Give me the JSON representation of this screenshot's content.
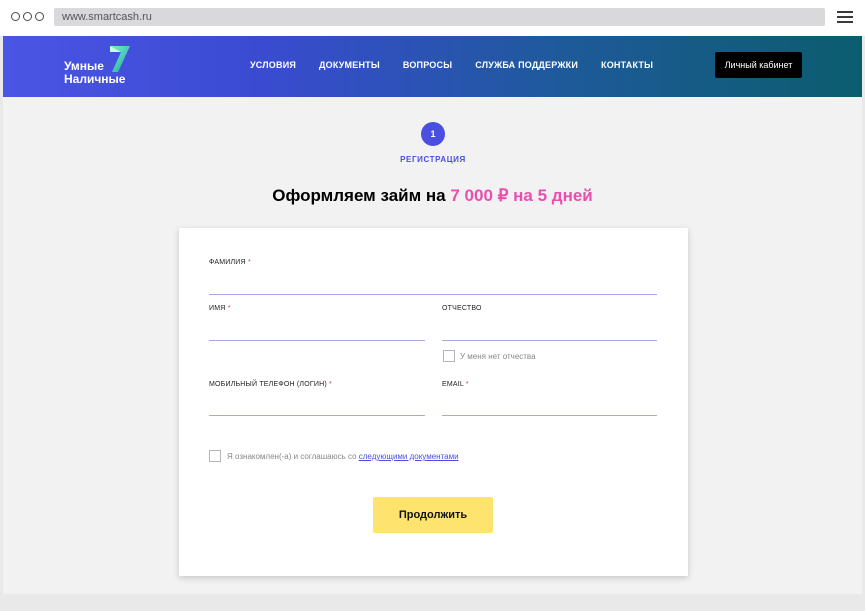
{
  "browser": {
    "url": "www.smartcash.ru"
  },
  "header": {
    "logo_line1": "Умные",
    "logo_line2": "Наличные",
    "nav": [
      {
        "label": "УСЛОВИЯ"
      },
      {
        "label": "ДОКУМЕНТЫ"
      },
      {
        "label": "ВОПРОСЫ"
      },
      {
        "label": "СЛУЖБА ПОДДЕРЖКИ"
      },
      {
        "label": "КОНТАКТЫ"
      }
    ],
    "account_button": "Личный кабинет"
  },
  "steps": {
    "current_number": "1",
    "current_label": "РЕГИСТРАЦИЯ"
  },
  "title": {
    "prefix": "Оформляем займ на ",
    "amount": "7 000 ₽ на 5 дней"
  },
  "form": {
    "surname_label": "ФАМИЛИЯ",
    "name_label": "ИМЯ",
    "patronymic_label": "ОТЧЕСТВО",
    "no_patronymic": "У меня нет отчества",
    "phone_label": "МОБИЛЬНЫЙ ТЕЛЕФОН (ЛОГИН)",
    "email_label": "EMAIL",
    "required_mark": "*",
    "agree_text": "Я ознакомлен(-а) и соглашаюсь со ",
    "agree_link": "следующими документами",
    "submit": "Продолжить"
  },
  "colors": {
    "brand_blue": "#4a4fe0",
    "accent_pink": "#e94fae",
    "button_yellow": "#fee36e"
  }
}
